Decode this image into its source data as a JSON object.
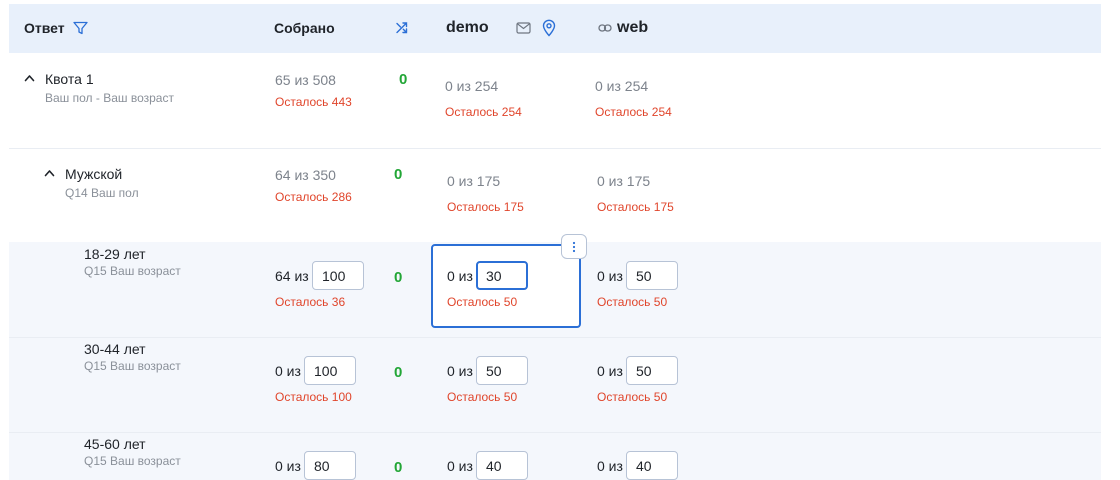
{
  "header": {
    "answer": "Ответ",
    "collected": "Собрано",
    "demo": "demo",
    "web": "web"
  },
  "rows": [
    {
      "label": "Квота 1",
      "sub": "Ваш пол - Ваш возраст",
      "collected": "65 из 508",
      "collected_left": "Осталось 443",
      "delta": "0",
      "demo": "0 из 254",
      "demo_left": "Осталось 254",
      "web": "0 из 254",
      "web_left": "Осталось 254"
    },
    {
      "label": "Мужской",
      "sub": "Q14 Ваш пол",
      "collected": "64 из 350",
      "collected_left": "Осталось 286",
      "delta": "0",
      "demo": "0 из 175",
      "demo_left": "Осталось 175",
      "web": "0 из 175",
      "web_left": "Осталось 175"
    },
    {
      "label": "18-29 лет",
      "sub": "Q15 Ваш возраст",
      "collected_of": "64 из",
      "collected_value": "100",
      "collected_left": "Осталось 36",
      "delta": "0",
      "demo_of": "0 из",
      "demo_value": "30",
      "demo_left": "Осталось 50",
      "web_of": "0 из",
      "web_value": "50",
      "web_left": "Осталось 50"
    },
    {
      "label": "30-44 лет",
      "sub": "Q15 Ваш возраст",
      "collected_of": "0 из",
      "collected_value": "100",
      "collected_left": "Осталось 100",
      "delta": "0",
      "demo_of": "0 из",
      "demo_value": "50",
      "demo_left": "Осталось 50",
      "web_of": "0 из",
      "web_value": "50",
      "web_left": "Осталось 50"
    },
    {
      "label": "45-60 лет",
      "sub": "Q15 Ваш возраст",
      "collected_of": "0 из",
      "collected_value": "80",
      "delta": "0",
      "demo_of": "0 из",
      "demo_value": "40",
      "web_of": "0 из",
      "web_value": "40"
    }
  ],
  "colors": {
    "accent": "#2b6fd6",
    "header_bg": "#e8f0fb",
    "remaining": "#e0452b",
    "delta": "#22a636"
  },
  "icons": [
    "filter-icon",
    "shuffle-icon",
    "mail-icon",
    "location-pin-icon",
    "link-icon",
    "chevron-up-icon",
    "more-vertical-icon"
  ]
}
